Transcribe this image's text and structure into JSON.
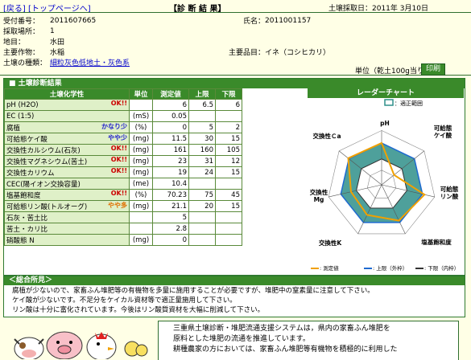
{
  "nav": {
    "back": "[戻る]",
    "top": "[トップページへ]"
  },
  "title": "【診 断 結 果】",
  "sample_date": "土壌採取日：2011年 3月10日",
  "info": {
    "receipt_label": "受付番号：",
    "receipt_value": "2011607665",
    "name_label": "氏名：",
    "name_value": "2011001157",
    "site_label": "採取場所：",
    "site_value": "1",
    "land_label": "地目：",
    "land_value": "水田",
    "crop_label": "主要作物：",
    "crop_value": "水稲",
    "variety_label": "主要品目：",
    "variety_value": "イネ（コシヒカリ）",
    "soil_label": "土壌の種類：",
    "soil_value": "細粒灰色低地土・灰色系",
    "unit_note": "単位（乾土100g当り）",
    "print": "印刷"
  },
  "soil_box": {
    "header": "■ 土壌診断結果",
    "columns": [
      "土壌化学性",
      "単位",
      "測定値",
      "上限",
      "下限"
    ],
    "rows": [
      {
        "name": "pH (H2O)",
        "tag": "OK!!",
        "tag_color": "ok",
        "unit": "",
        "value": "6",
        "upper": "6.5",
        "lower": "6"
      },
      {
        "name": "EC (1:5)",
        "tag": "",
        "tag_color": "",
        "unit": "(mS)",
        "value": "0.05",
        "upper": "",
        "lower": ""
      },
      {
        "name": "腐植",
        "tag": "かなり少",
        "tag_color": "blue",
        "unit": "(%)",
        "value": "0",
        "upper": "5",
        "lower": "2"
      },
      {
        "name": "可給態ケイ酸",
        "tag": "やや少",
        "tag_color": "blue",
        "unit": "(mg)",
        "value": "11.5",
        "upper": "30",
        "lower": "15"
      },
      {
        "name": "交換性カルシウム(石灰)",
        "tag": "OK!!",
        "tag_color": "ok",
        "unit": "(mg)",
        "value": "161",
        "upper": "160",
        "lower": "105"
      },
      {
        "name": "交換性マグネシウム(苦土)",
        "tag": "OK!!",
        "tag_color": "ok",
        "unit": "(mg)",
        "value": "23",
        "upper": "31",
        "lower": "12"
      },
      {
        "name": "交換性カリウム",
        "tag": "OK!!",
        "tag_color": "ok",
        "unit": "(mg)",
        "value": "19",
        "upper": "24",
        "lower": "15"
      },
      {
        "name": "CEC(陽イオン交換容量)",
        "tag": "",
        "tag_color": "",
        "unit": "(me)",
        "value": "10.4",
        "upper": "",
        "lower": ""
      },
      {
        "name": "塩基飽和度",
        "tag": "OK!!",
        "tag_color": "ok",
        "unit": "(%)",
        "value": "70.23",
        "upper": "75",
        "lower": "45"
      },
      {
        "name": "可給態リン酸(トルオーグ)",
        "tag": "やや多",
        "tag_color": "orange",
        "unit": "(mg)",
        "value": "21.1",
        "upper": "20",
        "lower": "15"
      },
      {
        "name": "石灰・苦土比",
        "tag": "",
        "tag_color": "",
        "unit": "",
        "value": "5",
        "upper": "",
        "lower": ""
      },
      {
        "name": "苦土・カリ比",
        "tag": "",
        "tag_color": "",
        "unit": "",
        "value": "2.8",
        "upper": "",
        "lower": ""
      },
      {
        "name": "硝酸態 N",
        "tag": "",
        "tag_color": "",
        "unit": "(mg)",
        "value": "0",
        "upper": "",
        "lower": ""
      }
    ]
  },
  "radar": {
    "header": "レーダーチャート",
    "legend_top": "：適正範囲",
    "legend_bottom": [
      ": 測定値",
      ": 上限（外枠）",
      ": 下限（内枠）"
    ],
    "axes": [
      "pH",
      "可給態ケイ酸",
      "可給態リン酸",
      "塩基飽和度",
      "交換性K",
      "交換性Mg",
      "交換性Ca"
    ],
    "axis_labels": {
      "ph": "pH",
      "si": [
        "可給態",
        "ケイ酸"
      ],
      "p": [
        "可給態",
        "リン酸"
      ],
      "base": "塩基飽和度",
      "k": "交換性K",
      "mg": [
        "交換性",
        "Mg"
      ],
      "ca": "交換性Ｃa"
    },
    "colors": {
      "measured": "#f0a000",
      "upper": "#1e6ad0",
      "range": "#2f8f8a",
      "inner": "#333333"
    },
    "measured_level": [
      1.0,
      0.38,
      1.05,
      0.95,
      0.8,
      0.75,
      1.02
    ]
  },
  "comment": {
    "header": "＜総合所見＞",
    "lines": [
      "腐植が少ないので、家畜ふん堆肥等の有機物を多量に施用することが必要ですが、堆肥中の窒素量に注意して下さい。",
      "ケイ酸が少ないです。不足分をケイカル資材等で適正量施用して下さい。",
      "リン酸は十分に富化されています。今後はリン酸質資材を大幅に削減して下さい。"
    ]
  },
  "banner": {
    "lines": [
      "三重県土壌診断・堆肥流通支援システムは，県内の家畜ふん堆肥を",
      "原料とした堆肥の流通を推進しています。",
      "耕種農家の方においては、家畜ふん堆肥等有機物を積極的に利用した"
    ]
  }
}
